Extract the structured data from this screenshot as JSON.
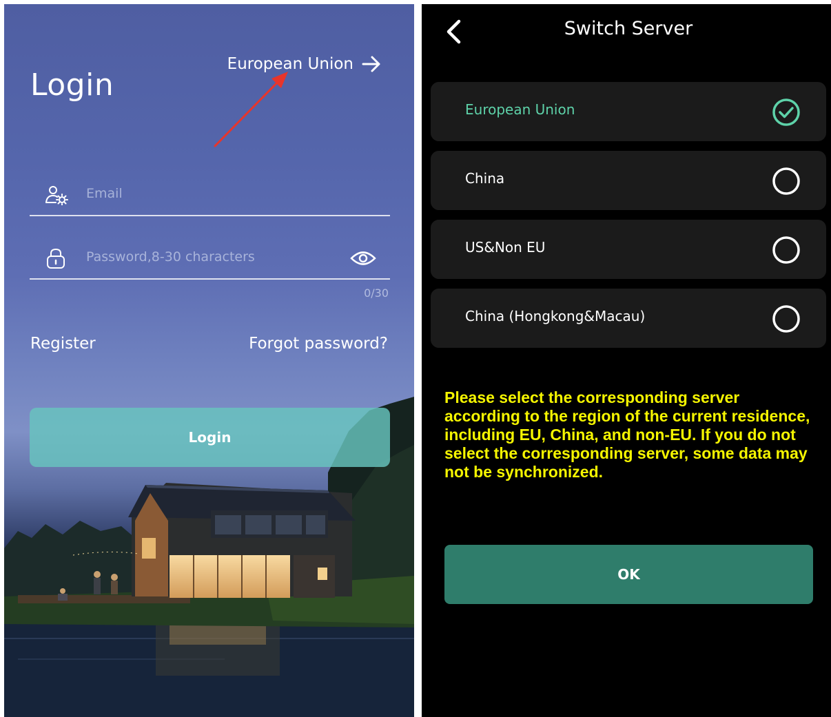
{
  "login_screen": {
    "title": "Login",
    "region_label": "European Union",
    "region_arrow_icon": "arrow-right-icon",
    "email_placeholder": "Email",
    "email_icon": "user-settings-icon",
    "password_placeholder": "Password,8-30 characters",
    "password_icon": "lock-icon",
    "visibility_icon": "eye-icon",
    "char_counter": "0/30",
    "register_label": "Register",
    "forgot_label": "Forgot password?",
    "login_button_label": "Login",
    "annotation_color": "#e8352b",
    "button_color": "#68c4be"
  },
  "server_screen": {
    "title": "Switch Server",
    "back_icon": "chevron-left-icon",
    "servers": [
      {
        "name": "European Union",
        "selected": true
      },
      {
        "name": "China",
        "selected": false
      },
      {
        "name": "US&Non EU",
        "selected": false
      },
      {
        "name": "China (Hongkong&Macau)",
        "selected": false
      }
    ],
    "notice": "Please select the corresponding server according to the region of the current residence, including EU, China, and non-EU. If you do not select the corresponding server, some data may not be synchronized.",
    "ok_label": "OK",
    "accent_color": "#5ed2a9",
    "notice_color": "#f5f500",
    "ok_button_color": "#2f7d6b"
  }
}
